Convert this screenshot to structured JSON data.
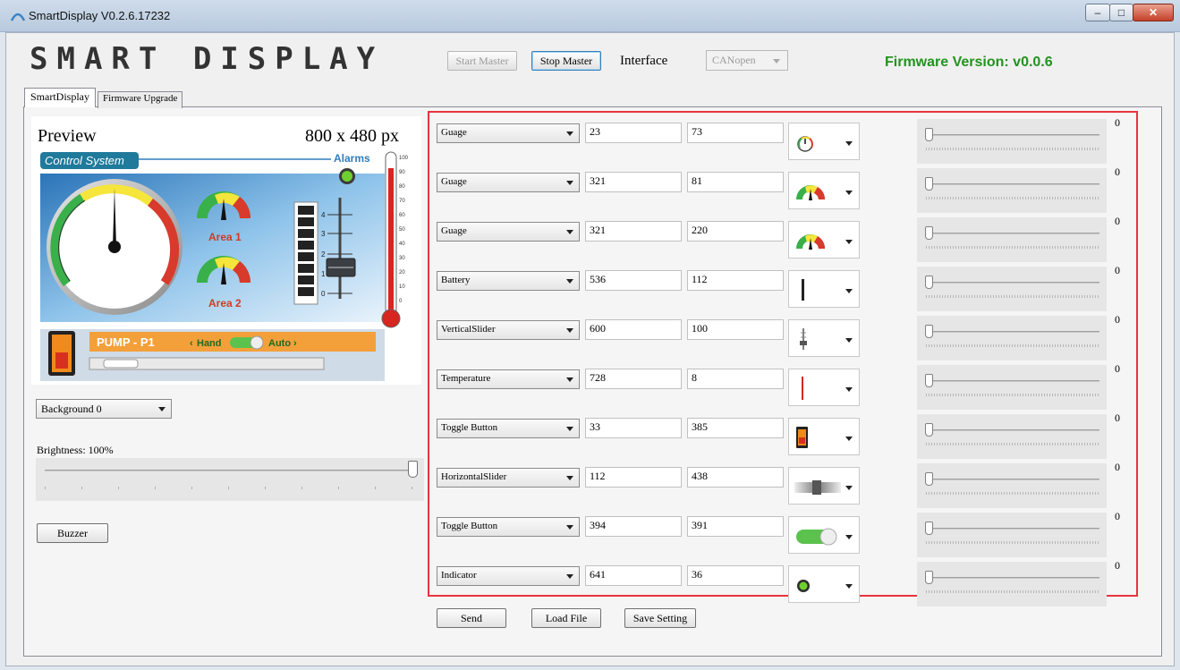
{
  "window": {
    "title": "SmartDisplay V0.2.6.17232",
    "min": "–",
    "max": "□",
    "close": "✕"
  },
  "header": {
    "logo": "SMART DISPLAY",
    "start_master": "Start Master",
    "stop_master": "Stop Master",
    "interface_label": "Interface",
    "interface_value": "CANopen",
    "firmware_version": "Firmware Version:  v0.0.6"
  },
  "tabs": [
    "SmartDisplay",
    "Firmware Upgrade"
  ],
  "preview": {
    "title": "Preview",
    "size": "800 x 480 px",
    "screen": {
      "section_title": "Control System",
      "alarms_label": "Alarms",
      "area1": "Area 1",
      "area2": "Area 2",
      "pump": "PUMP - P1",
      "hand": "Hand",
      "auto": "Auto",
      "temp_ticks": [
        "100",
        "90",
        "80",
        "70",
        "60",
        "50",
        "40",
        "30",
        "20",
        "10",
        "0"
      ],
      "slider_ticks": [
        "4",
        "3",
        "2",
        "1",
        "0"
      ]
    }
  },
  "background_select": "Background 0",
  "brightness": {
    "label": "Brightness:",
    "value": "100%",
    "level": 1.0
  },
  "buzzer": "Buzzer",
  "widgets": [
    {
      "type": "Guage",
      "x": "23",
      "y": "73",
      "icon": "small-gauge-icon",
      "slider_value": "0"
    },
    {
      "type": "Guage",
      "x": "321",
      "y": "81",
      "icon": "color-gauge-icon",
      "slider_value": "0"
    },
    {
      "type": "Guage",
      "x": "321",
      "y": "220",
      "icon": "color-gauge-icon",
      "slider_value": "0"
    },
    {
      "type": "Battery",
      "x": "536",
      "y": "112",
      "icon": "battery-icon",
      "slider_value": "0"
    },
    {
      "type": "VerticalSlider",
      "x": "600",
      "y": "100",
      "icon": "vertical-slider-icon",
      "slider_value": "0"
    },
    {
      "type": "Temperature",
      "x": "728",
      "y": "8",
      "icon": "temperature-icon",
      "slider_value": "0"
    },
    {
      "type": "Toggle Button",
      "x": "33",
      "y": "385",
      "icon": "toggle-switch-icon",
      "slider_value": "0"
    },
    {
      "type": "HorizontalSlider",
      "x": "112",
      "y": "438",
      "icon": "horizontal-slider-icon",
      "slider_value": "0"
    },
    {
      "type": "Toggle Button",
      "x": "394",
      "y": "391",
      "icon": "toggle-pill-icon",
      "slider_value": "0"
    },
    {
      "type": "Indicator",
      "x": "641",
      "y": "36",
      "icon": "indicator-led-icon",
      "slider_value": "0"
    }
  ],
  "actions": {
    "send": "Send",
    "load_file": "Load File",
    "save_setting": "Save Setting"
  },
  "colors": {
    "firmware": "#22931e",
    "highlight_border": "#e8343f",
    "screen_blue": "#2f7ec1",
    "pump_orange": "#f39a1e"
  }
}
